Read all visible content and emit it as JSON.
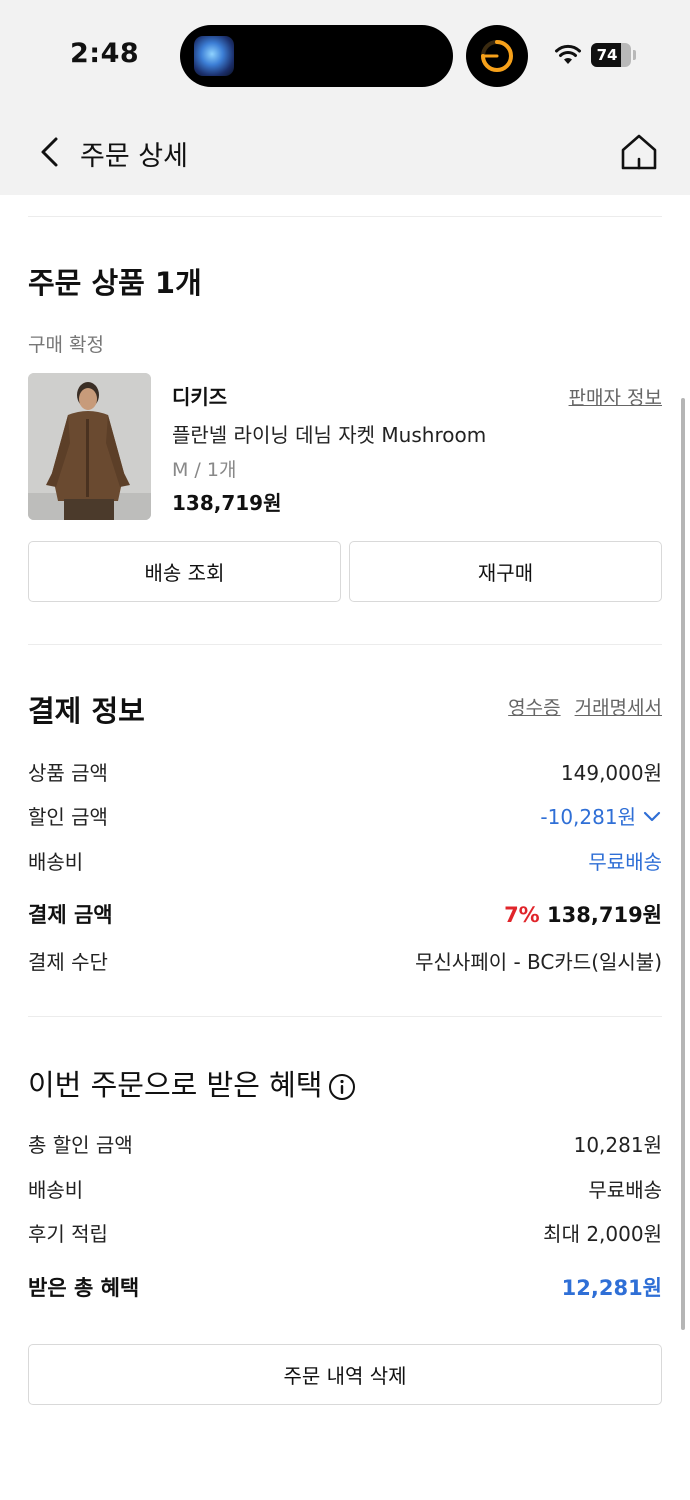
{
  "status_bar": {
    "time": "2:48",
    "battery_text": "74",
    "battery_level_percent": 74,
    "icons": [
      "app-artwork-icon",
      "timer-icon",
      "wifi-icon",
      "battery-icon"
    ]
  },
  "nav": {
    "title": "주문 상세",
    "icons": [
      "back-chevron-icon",
      "home-icon"
    ]
  },
  "order_products": {
    "title": "주문 상품 1개",
    "status": "구매 확정",
    "seller_link": "판매자 정보",
    "item": {
      "brand": "디키즈",
      "name": "플란넬 라이닝 데님 자켓 Mushroom",
      "option": "M / 1개",
      "price": "138,719원"
    },
    "buttons": {
      "track": "배송 조회",
      "rebuy": "재구매"
    }
  },
  "payment": {
    "title": "결제 정보",
    "receipt_link": "영수증",
    "statement_link": "거래명세서",
    "product_amount_label": "상품 금액",
    "product_amount_value": "149,000원",
    "discount_label": "할인 금액",
    "discount_value": "-10,281원",
    "shipping_label": "배송비",
    "shipping_value": "무료배송",
    "total_label": "결제 금액",
    "total_percent": "7%",
    "total_value": "138,719원",
    "method_label": "결제 수단",
    "method_value": "무신사페이 - BC카드(일시불)"
  },
  "benefits": {
    "title": "이번 주문으로 받은 혜택",
    "total_discount_label": "총 할인 금액",
    "total_discount_value": "10,281원",
    "shipping_label": "배송비",
    "shipping_value": "무료배송",
    "review_label": "후기 적립",
    "review_value": "최대 2,000원",
    "received_label": "받은 총 혜택",
    "received_value": "12,281원"
  },
  "delete_button": "주문 내역 삭제",
  "colors": {
    "accent_blue": "#2f6fd6",
    "discount_red": "#e0252b",
    "header_bg": "#f2f2f2"
  }
}
